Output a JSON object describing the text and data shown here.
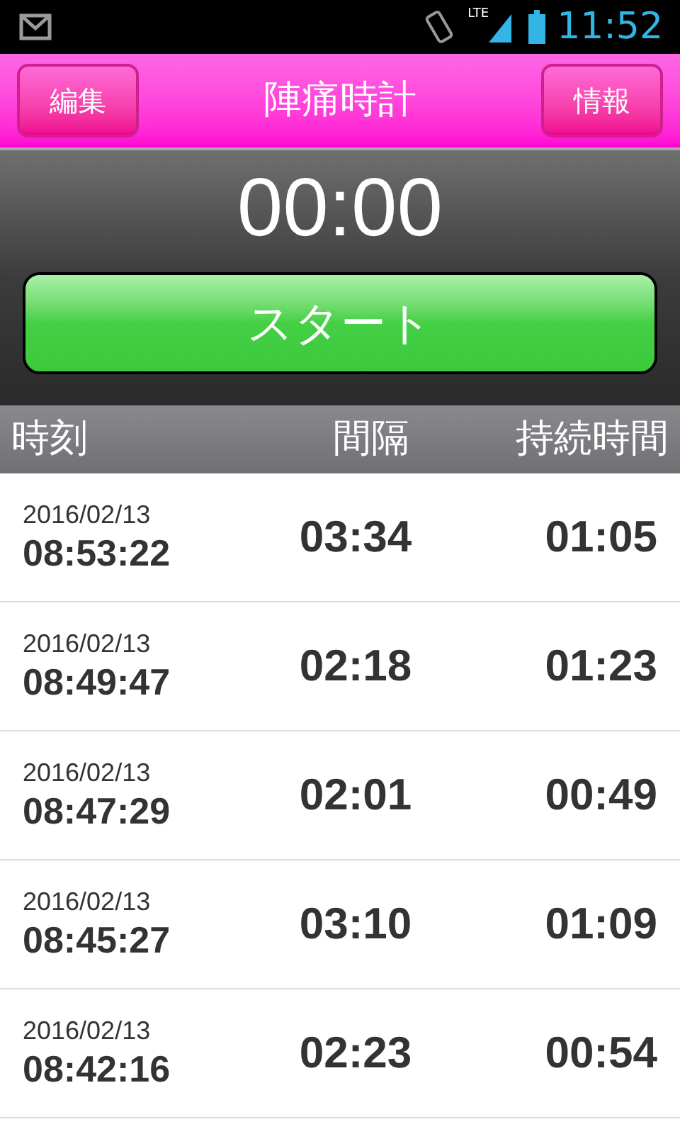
{
  "status_bar": {
    "network": "LTE",
    "time": "11:52"
  },
  "header": {
    "left_button": "編集",
    "title": "陣痛時計",
    "right_button": "情報"
  },
  "timer": {
    "display": "00:00",
    "start_button": "スタート"
  },
  "table": {
    "columns": [
      "時刻",
      "間隔",
      "持続時間"
    ],
    "rows": [
      {
        "date": "2016/02/13",
        "time": "08:53:22",
        "interval": "03:34",
        "duration": "01:05"
      },
      {
        "date": "2016/02/13",
        "time": "08:49:47",
        "interval": "02:18",
        "duration": "01:23"
      },
      {
        "date": "2016/02/13",
        "time": "08:47:29",
        "interval": "02:01",
        "duration": "00:49"
      },
      {
        "date": "2016/02/13",
        "time": "08:45:27",
        "interval": "03:10",
        "duration": "01:09"
      },
      {
        "date": "2016/02/13",
        "time": "08:42:16",
        "interval": "02:23",
        "duration": "00:54"
      }
    ]
  }
}
